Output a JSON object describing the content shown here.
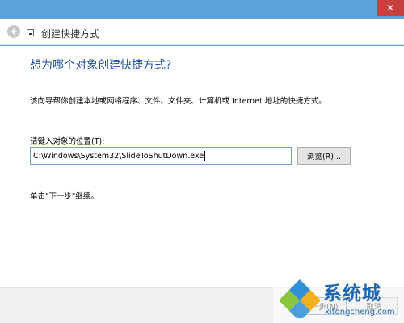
{
  "titlebar": {
    "close_icon": "✕"
  },
  "header": {
    "back_icon": "back-arrow-icon",
    "title": "创建快捷方式"
  },
  "main": {
    "heading": "想为哪个对象创建快捷方式?",
    "description": "该向导帮你创建本地或网络程序、文件、文件夹、计算机或 Internet 地址的快捷方式。",
    "location_label": "请键入对象的位置(T):",
    "location_value": "C:\\Windows\\System32\\SlideToShutDown.exe",
    "browse_label": "浏览(R)...",
    "hint": "单击\"下一步\"继续。"
  },
  "footer": {
    "next_label": "下一步(N)",
    "cancel_label": "取消"
  },
  "watermark": {
    "text": "系统城",
    "url": "xitongcheng.com"
  },
  "colors": {
    "frame": "#5aa3dd",
    "heading": "#1e4ea1",
    "close": "#c74040",
    "watermark": "#1f67b0"
  }
}
